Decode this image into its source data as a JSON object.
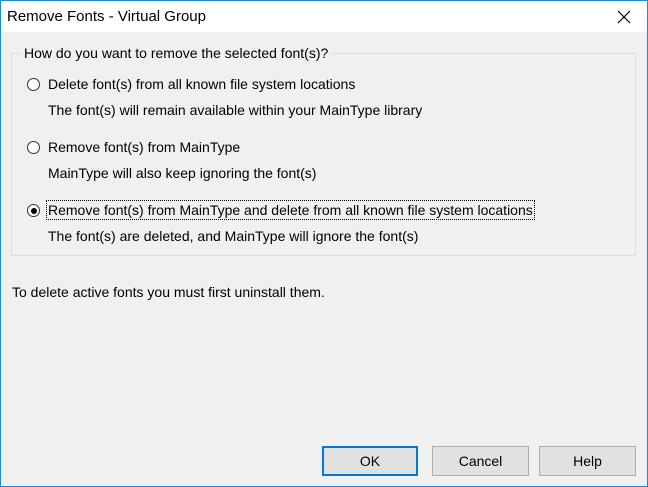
{
  "window": {
    "title": "Remove Fonts - Virtual Group"
  },
  "group": {
    "legend": "How do you want to remove the selected font(s)?",
    "options": [
      {
        "label": "Delete font(s) from all known file system locations",
        "description": "The font(s) will remain available within your MainType library",
        "checked": false
      },
      {
        "label": "Remove font(s) from MainType",
        "description": "MainType will also keep ignoring the font(s)",
        "checked": false
      },
      {
        "label": "Remove font(s) from MainType and delete from all known file system locations",
        "description": "The font(s) are deleted, and MainType will ignore the font(s)",
        "checked": true
      }
    ]
  },
  "note": "To delete active fonts you must first uninstall them.",
  "buttons": {
    "ok": "OK",
    "cancel": "Cancel",
    "help": "Help"
  },
  "colors": {
    "window_border": "#1f8ad2",
    "default_button_border": "#0078d7",
    "dialog_background": "#f0f0f0"
  }
}
